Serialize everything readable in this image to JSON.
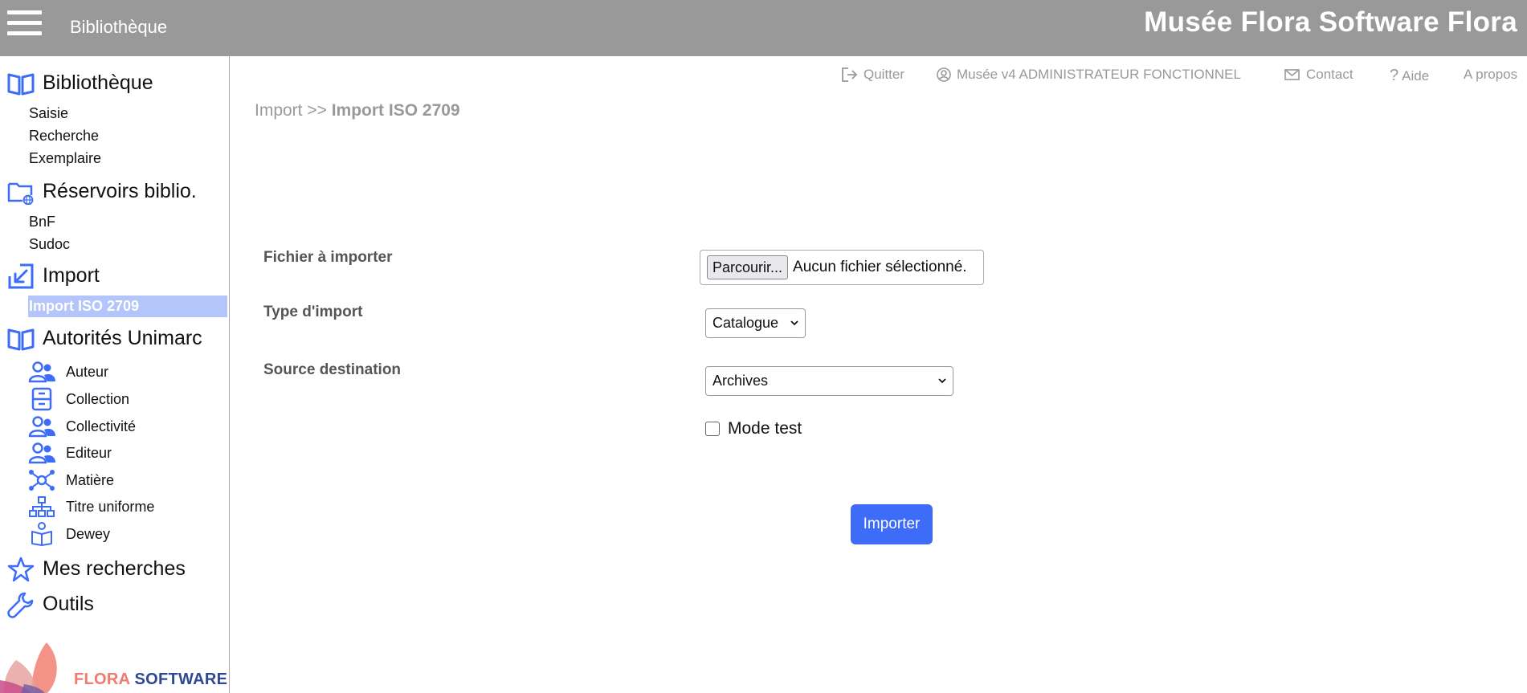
{
  "header": {
    "app_name": "Bibliothèque",
    "brand": "Musée Flora Software Flora"
  },
  "sidebar": {
    "sections": [
      {
        "label": "Bibliothèque",
        "icon": "open-book-icon",
        "items": [
          "Saisie",
          "Recherche",
          "Exemplaire"
        ]
      },
      {
        "label": "Réservoirs biblio.",
        "icon": "folder-globe-icon",
        "items": [
          "BnF",
          "Sudoc"
        ]
      },
      {
        "label": "Import",
        "icon": "import-arrow-icon",
        "items": [
          "Import ISO 2709"
        ]
      },
      {
        "label": "Autorités Unimarc",
        "icon": "open-book-icon",
        "items": [
          "Auteur",
          "Collection",
          "Collectivité",
          "Editeur",
          "Matière",
          "Titre uniforme",
          "Dewey"
        ]
      },
      {
        "label": "Mes recherches",
        "icon": "star-icon",
        "items": []
      },
      {
        "label": "Outils",
        "icon": "wrench-icon",
        "items": []
      }
    ],
    "active_item": "Import ISO 2709",
    "logo": {
      "part1": "FLORA",
      "part2": "SOFTWARE"
    }
  },
  "toplinks": {
    "quit": "Quitter",
    "user": "Musée v4 ADMINISTRATEUR FONCTIONNEL",
    "contact": "Contact",
    "help": "Aide",
    "about": "A propos"
  },
  "breadcrumb": {
    "parent": "Import >> ",
    "current": "Import ISO 2709"
  },
  "form": {
    "file_label": "Fichier à importer",
    "file_button": "Parcourir...",
    "file_status": "Aucun fichier sélectionné.",
    "type_label": "Type d'import",
    "type_value": "Catalogue",
    "source_label": "Source destination",
    "source_value": "Archives",
    "test_mode_label": "Mode test",
    "submit_label": "Importer"
  },
  "colors": {
    "accent": "#3d6cf8",
    "header": "#999999",
    "icon": "#3d6cf8",
    "active_bg": "#b3c5fa"
  }
}
